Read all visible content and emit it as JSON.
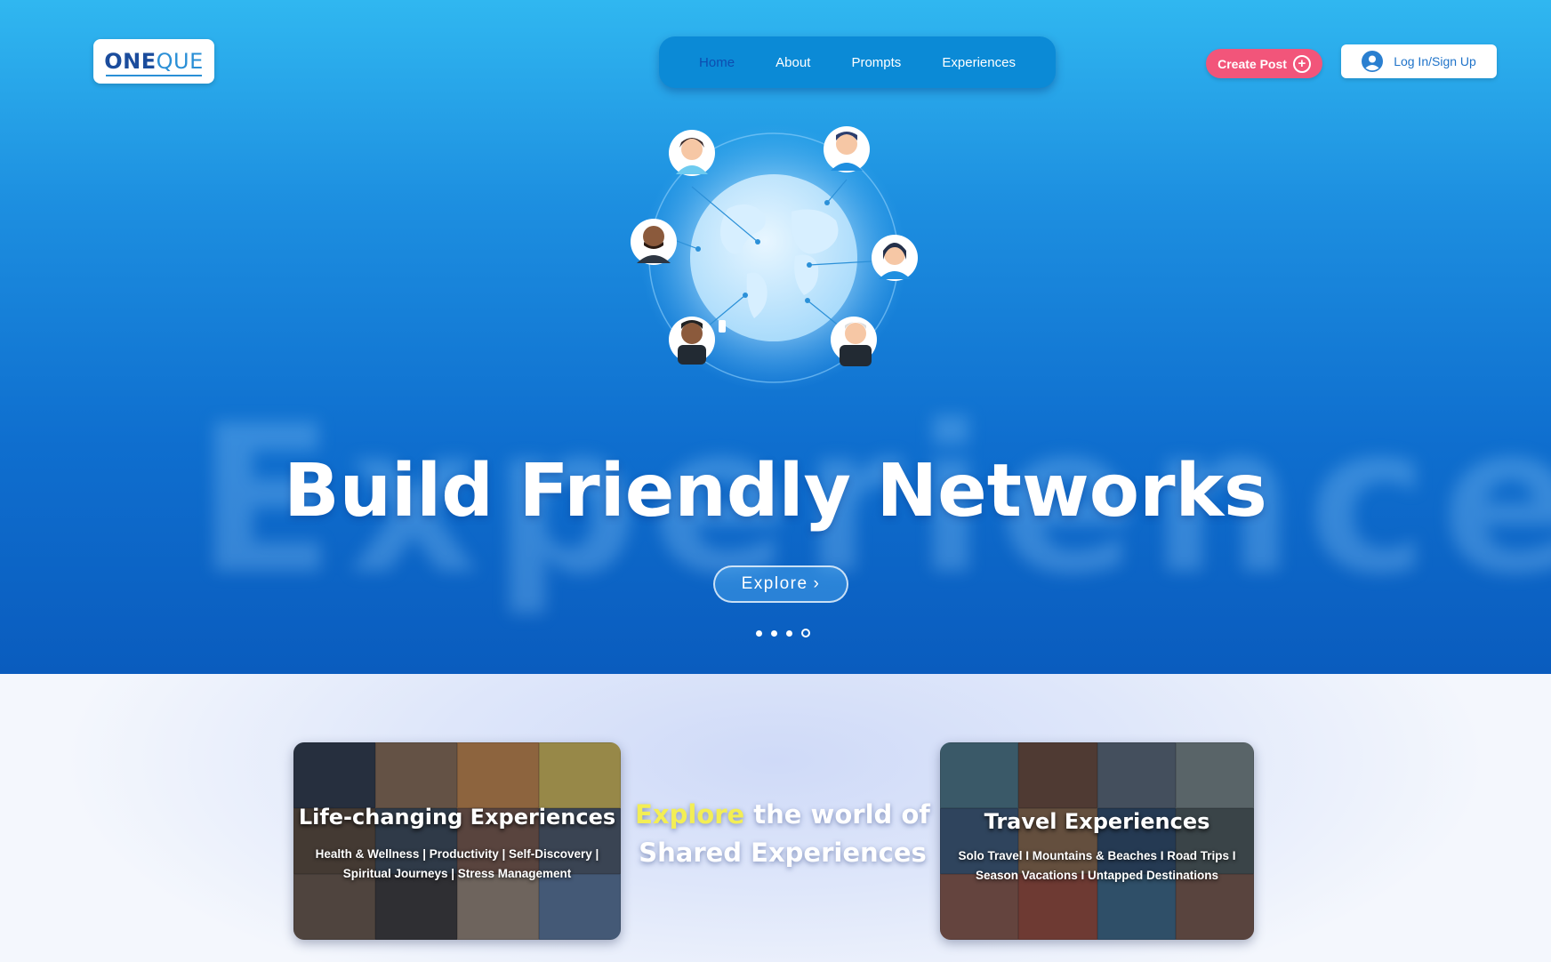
{
  "brand": {
    "logo_part1": "ONE",
    "logo_part2": "QUE"
  },
  "nav": {
    "items": [
      {
        "label": "Home",
        "active": true
      },
      {
        "label": "About"
      },
      {
        "label": "Prompts"
      },
      {
        "label": "Experiences"
      }
    ]
  },
  "header": {
    "create_post_label": "Create Post",
    "login_label": "Log In/Sign Up"
  },
  "hero": {
    "background_word": "Experiences",
    "title": "Build Friendly Networks",
    "explore_label": "Explore",
    "carousel": {
      "total": 4,
      "active_index": 4
    }
  },
  "lower": {
    "tagline_highlight": "Explore",
    "tagline_rest_1": " the world of",
    "tagline_rest_2": "Shared Experiences",
    "cards": [
      {
        "title": "Life-changing Experiences",
        "subtitle_line1": "Health & Wellness | Productivity | Self-Discovery |",
        "subtitle_line2": "Spiritual Journeys | Stress Management"
      },
      {
        "title": "Travel Experiences",
        "subtitle_line1": "Solo Travel I Mountains & Beaches I Road Trips I",
        "subtitle_line2": "Season Vacations I Untapped Destinations"
      }
    ]
  },
  "colors": {
    "hero_top": "#30b7f0",
    "hero_bottom": "#0a5cbe",
    "nav_bg": "#0b8ad6",
    "accent_pink": "#f2557a",
    "highlight_yellow": "#f3ee55"
  }
}
